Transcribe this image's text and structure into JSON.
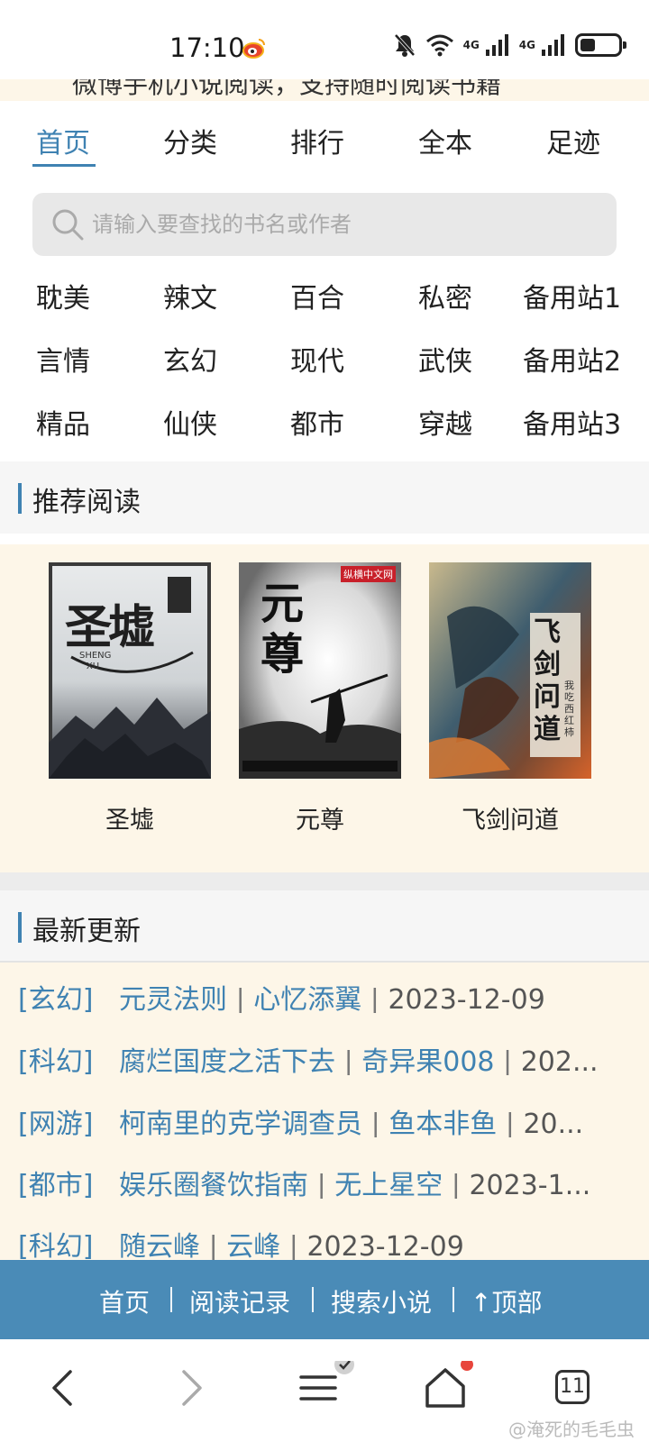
{
  "status_bar": {
    "time": "17:10",
    "signal1_label": "4G",
    "signal2_label": "4G",
    "icons": [
      "weibo-icon",
      "bell-muted-icon",
      "wifi-icon",
      "signal-icon",
      "battery-icon"
    ]
  },
  "banner": {
    "text": "微博手机小说阅读，支持随时阅读书籍"
  },
  "nav": {
    "tabs": [
      {
        "label": "首页",
        "active": true
      },
      {
        "label": "分类"
      },
      {
        "label": "排行"
      },
      {
        "label": "全本"
      },
      {
        "label": "足迹"
      }
    ]
  },
  "search": {
    "placeholder": "请输入要查找的书名或作者"
  },
  "categories": {
    "rows": [
      [
        "耽美",
        "辣文",
        "百合",
        "私密",
        "备用站1"
      ],
      [
        "言情",
        "玄幻",
        "现代",
        "武侠",
        "备用站2"
      ],
      [
        "精品",
        "仙侠",
        "都市",
        "穿越",
        "备用站3"
      ]
    ]
  },
  "recommend": {
    "title": "推荐阅读",
    "books": [
      {
        "title": "圣墟",
        "cover_text": "圣墟",
        "cover_sub": "SHENG XU"
      },
      {
        "title": "元尊",
        "cover_text": "元尊",
        "cover_badge": "纵横中文网"
      },
      {
        "title": "飞剑问道",
        "cover_text": "飞剑问道",
        "cover_author": "我吃西红柿"
      }
    ]
  },
  "latest": {
    "title": "最新更新",
    "rows": [
      {
        "cat": "[玄幻]",
        "book": "元灵法则",
        "author": "心忆添翼",
        "date": "2023-12-09"
      },
      {
        "cat": "[科幻]",
        "book": "腐烂国度之活下去",
        "author": "奇异果008",
        "date": "202..."
      },
      {
        "cat": "[网游]",
        "book": "柯南里的克学调查员",
        "author": "鱼本非鱼",
        "date": "20..."
      },
      {
        "cat": "[都市]",
        "book": "娱乐圈餐饮指南",
        "author": "无上星空",
        "date": "2023-1..."
      },
      {
        "cat": "[科幻]",
        "book": "随云峰",
        "author": "云峰",
        "date": "2023-12-09"
      }
    ]
  },
  "bottom_nav": {
    "items": [
      "首页",
      "阅读记录",
      "搜索小说",
      "↑顶部"
    ]
  },
  "browser_bar": {
    "tab_count": "11",
    "watermark": "@淹死的毛毛虫"
  },
  "colors": {
    "accent": "#3f82b2",
    "bottom_nav_bg": "#4a8bb7",
    "cream_bg": "#fdf6e8"
  }
}
